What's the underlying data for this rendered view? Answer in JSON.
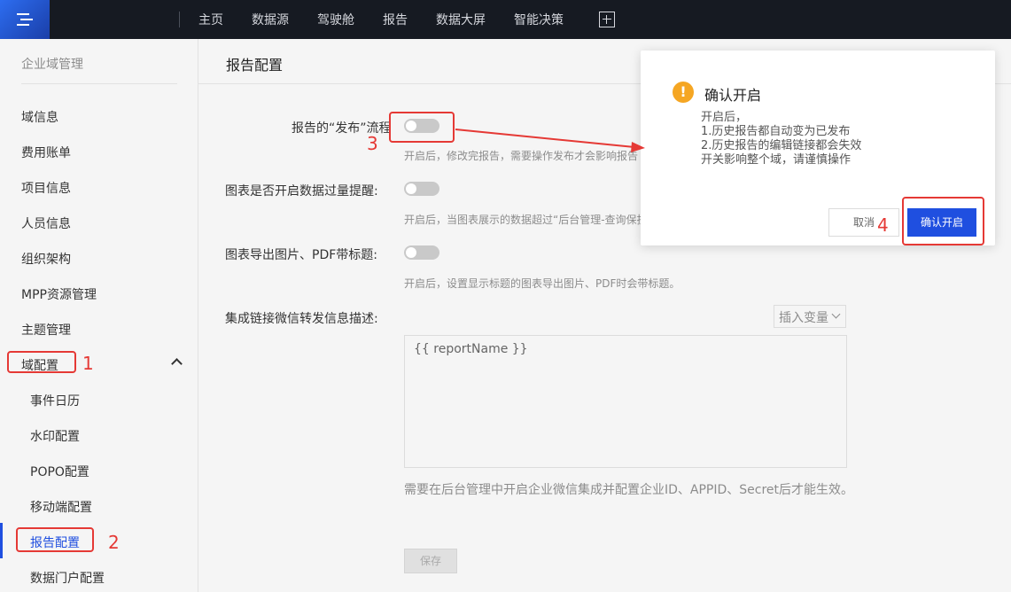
{
  "topbar": {
    "nav": [
      "主页",
      "数据源",
      "驾驶舱",
      "报告",
      "数据大屏",
      "智能决策"
    ]
  },
  "sidebar": {
    "group_title": "企业域管理",
    "items": [
      "域信息",
      "费用账单",
      "项目信息",
      "人员信息",
      "组织架构",
      "MPP资源管理",
      "主题管理",
      "域配置"
    ],
    "sub_items": [
      "事件日历",
      "水印配置",
      "POPO配置",
      "移动端配置",
      "报告配置",
      "数据门户配置"
    ]
  },
  "main": {
    "title": "报告配置",
    "settings": [
      {
        "label": "报告的“发布”流程",
        "hint": "开启后，修改完报告，需要操作发布才会影响报告"
      },
      {
        "label": "图表是否开启数据过量提醒:",
        "hint": "开启后，当图表展示的数据超过“后台管理-查询保护"
      },
      {
        "label": "图表导出图片、PDF带标题:",
        "hint": "开启后，设置显示标题的图表导出图片、PDF时会带标题。"
      }
    ],
    "share_label": "集成链接微信转发信息描述:",
    "insert_var": "插入变量",
    "textarea_value": "{{ reportName }}",
    "note": "需要在后台管理中开启企业微信集成并配置企业ID、APPID、Secret后才能生效。",
    "save": "保存"
  },
  "modal": {
    "title": "确认开启",
    "lines": [
      "开启后，",
      "1.历史报告都自动变为已发布",
      "2.历史报告的编辑链接都会失效",
      "开关影响整个域，请谨慎操作"
    ],
    "cancel": "取消",
    "confirm": "确认开启"
  },
  "annotations": [
    "1",
    "2",
    "3",
    "4"
  ],
  "colors": {
    "accent": "#1f4fe0",
    "annotation": "#e53935",
    "warning": "#f5a623",
    "topbar": "#161a22"
  }
}
